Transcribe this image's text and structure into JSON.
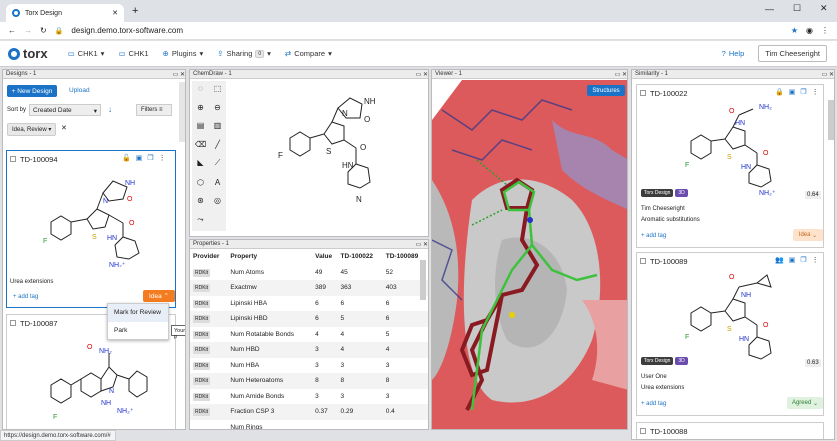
{
  "browser": {
    "tab_title": "Torx Design",
    "url": "design.demo.torx-software.com",
    "status_url": "https://design.demo.torx-software.com/#"
  },
  "app": {
    "logo": "torx",
    "chk1": "CHK1",
    "chk1b": "CHK1",
    "plugins": "Plugins",
    "sharing": "Sharing",
    "sharing_count": "0",
    "compare": "Compare",
    "help": "Help",
    "user": "Tim Cheeseright"
  },
  "designs": {
    "header": "Designs - 1",
    "new_design": "+ New Design",
    "upload": "Upload",
    "sort_label": "Sort by",
    "sort_value": "Created Date",
    "filters": "Filters",
    "filter_chip": "Idea, Review",
    "cards": [
      {
        "id": "TD-100094",
        "desc": "Urea extensions",
        "add_tag": "+ add tag",
        "status": "Idea"
      },
      {
        "id": "TD-100087"
      }
    ],
    "menu": [
      "Mark for Review",
      "Park"
    ],
    "tooltip": "Your p"
  },
  "chemdraw": {
    "header": "ChemDraw - 1"
  },
  "viewer": {
    "header": "Viewer - 1",
    "structures": "Structures"
  },
  "properties": {
    "header": "Properties - 1",
    "columns": [
      "Provider",
      "Property",
      "Value",
      "TD-100022",
      "TD-100089"
    ],
    "rows": [
      [
        "RDKit",
        "Num Atoms",
        "49",
        "45",
        "52"
      ],
      [
        "RDKit",
        "Exactmw",
        "389",
        "363",
        "403"
      ],
      [
        "RDKit",
        "Lipinski HBA",
        "6",
        "6",
        "6"
      ],
      [
        "RDKit",
        "Lipinski HBD",
        "6",
        "5",
        "6"
      ],
      [
        "RDKit",
        "Num Rotatable Bonds",
        "4",
        "4",
        "5"
      ],
      [
        "RDKit",
        "Num HBD",
        "3",
        "4",
        "4"
      ],
      [
        "RDKit",
        "Num HBA",
        "3",
        "3",
        "3"
      ],
      [
        "RDKit",
        "Num Heteroatoms",
        "8",
        "8",
        "8"
      ],
      [
        "RDKit",
        "Num Amide Bonds",
        "3",
        "3",
        "3"
      ],
      [
        "RDKit",
        "Fraction CSP 3",
        "0.37",
        "0.29",
        "0.4"
      ],
      [
        "",
        "Num Rings",
        "",
        "",
        ""
      ]
    ]
  },
  "similarity": {
    "header": "Similarity - 1",
    "cards": [
      {
        "id": "TD-100022",
        "tag": "Torx Design",
        "tag3d": "3D",
        "score": "0.64",
        "author": "Tim Cheeseright",
        "desc": "Aromatic substitutions",
        "add_tag": "+ add tag",
        "status": "Idea"
      },
      {
        "id": "TD-100089",
        "tag": "Torx Design",
        "tag3d": "3D",
        "score": "0.63",
        "author": "User One",
        "desc": "Urea extensions",
        "add_tag": "+ add tag",
        "status": "Agreed"
      },
      {
        "id": "TD-100088"
      }
    ]
  },
  "colors": {
    "accent": "#1a73c7",
    "idea": "#f47c20",
    "agreed": "#dff2e0"
  }
}
